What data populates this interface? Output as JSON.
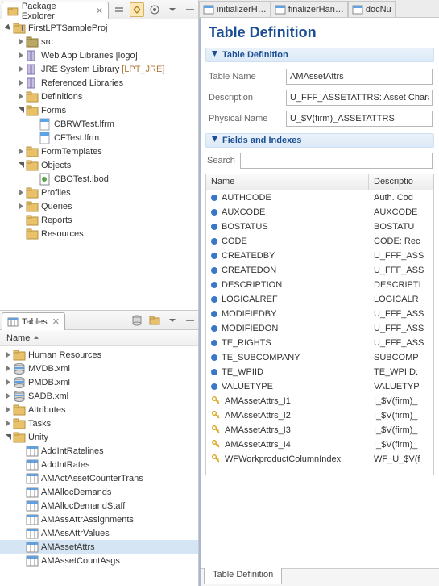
{
  "packageExplorer": {
    "title": "Package Explorer",
    "project": "FirstLPTSampleProj",
    "nodes": {
      "src": "src",
      "webapp": "Web App Libraries [logo]",
      "jre": "JRE System Library",
      "jreSuffix": "[LPT_JRE]",
      "reflib": "Referenced Libraries",
      "defs": "Definitions",
      "forms": "Forms",
      "form1": "CBRWTest.lfrm",
      "form2": "CFTest.lfrm",
      "formtpl": "FormTemplates",
      "objects": "Objects",
      "obj1": "CBOTest.lbod",
      "profiles": "Profiles",
      "queries": "Queries",
      "reports": "Reports",
      "resources": "Resources"
    }
  },
  "tablesView": {
    "title": "Tables",
    "header": "Name",
    "nodes": {
      "hr": "Human Resources",
      "mvdb": "MVDB.xml",
      "pmdb": "PMDB.xml",
      "sadb": "SADB.xml",
      "attrs": "Attributes",
      "tasks": "Tasks",
      "unity": "Unity",
      "t1": "AddIntRatelines",
      "t2": "AddIntRates",
      "t3": "AMActAssetCounterTrans",
      "t4": "AMAllocDemands",
      "t5": "AMAllocDemandStaff",
      "t6": "AMAssAttrAssignments",
      "t7": "AMAssAttrValues",
      "t8": "AMAssetAttrs",
      "t9": "AMAssetCountAsgs"
    }
  },
  "editor": {
    "tabs": [
      "initializerH…",
      "finalizerHan…",
      "docNu"
    ],
    "title": "Table Definition",
    "section1": "Table Definition",
    "section2": "Fields and Indexes",
    "labels": {
      "tableName": "Table Name",
      "description": "Description",
      "physicalName": "Physical Name",
      "search": "Search"
    },
    "values": {
      "tableName": "AMAssetAttrs",
      "description": "U_FFF_ASSETATTRS: Asset Characte",
      "physicalName": "U_$V(firm)_ASSETATTRS"
    },
    "cols": {
      "name": "Name",
      "desc": "Descriptio"
    },
    "bottomTab": "Table Definition"
  },
  "chart_data": {
    "type": "table",
    "columns": [
      "Name",
      "Description"
    ],
    "rows": [
      {
        "icon": "dot",
        "name": "AUTHCODE",
        "desc": "Auth. Cod"
      },
      {
        "icon": "dot",
        "name": "AUXCODE",
        "desc": "AUXCODE"
      },
      {
        "icon": "dot",
        "name": "BOSTATUS",
        "desc": "BOSTATU"
      },
      {
        "icon": "dot",
        "name": "CODE",
        "desc": "CODE: Rec"
      },
      {
        "icon": "dot",
        "name": "CREATEDBY",
        "desc": "U_FFF_ASS"
      },
      {
        "icon": "dot",
        "name": "CREATEDON",
        "desc": "U_FFF_ASS"
      },
      {
        "icon": "dot",
        "name": "DESCRIPTION",
        "desc": "DESCRIPTI"
      },
      {
        "icon": "dot",
        "name": "LOGICALREF",
        "desc": "LOGICALR"
      },
      {
        "icon": "dot",
        "name": "MODIFIEDBY",
        "desc": "U_FFF_ASS"
      },
      {
        "icon": "dot",
        "name": "MODIFIEDON",
        "desc": "U_FFF_ASS"
      },
      {
        "icon": "dot",
        "name": "TE_RIGHTS",
        "desc": "U_FFF_ASS"
      },
      {
        "icon": "dot",
        "name": "TE_SUBCOMPANY",
        "desc": "SUBCOMP"
      },
      {
        "icon": "dot",
        "name": "TE_WPIID",
        "desc": "TE_WPIID:"
      },
      {
        "icon": "dot",
        "name": "VALUETYPE",
        "desc": "VALUETYP"
      },
      {
        "icon": "key",
        "name": "AMAssetAttrs_I1",
        "desc": "I_$V(firm)_"
      },
      {
        "icon": "key",
        "name": "AMAssetAttrs_I2",
        "desc": "I_$V(firm)_"
      },
      {
        "icon": "key",
        "name": "AMAssetAttrs_I3",
        "desc": "I_$V(firm)_"
      },
      {
        "icon": "key",
        "name": "AMAssetAttrs_I4",
        "desc": "I_$V(firm)_"
      },
      {
        "icon": "key",
        "name": "WFWorkproductColumnIndex",
        "desc": "WF_U_$V(f"
      }
    ]
  }
}
